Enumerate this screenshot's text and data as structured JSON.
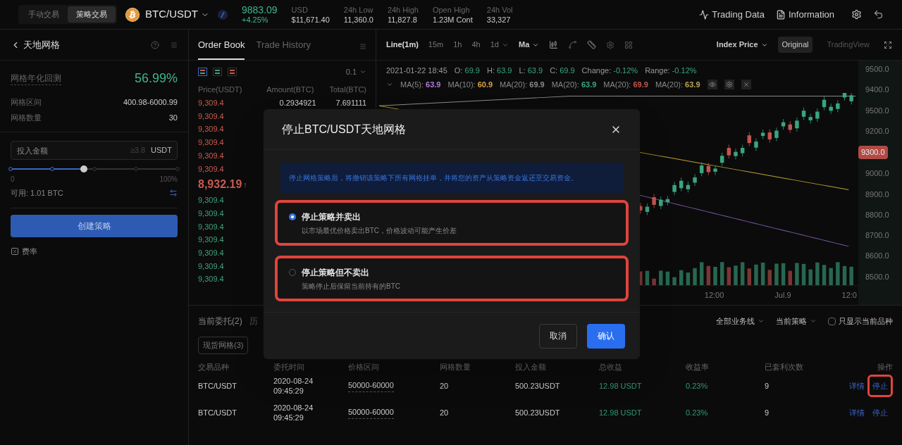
{
  "header": {
    "mode_tabs": [
      {
        "label": "手动交易",
        "selected": false
      },
      {
        "label": "策略交易",
        "selected": true
      }
    ],
    "pair": "BTC/USDT",
    "price": "9883.09",
    "change": "+4.25%",
    "stats": [
      {
        "label": "USD",
        "value": "$11,671.40"
      },
      {
        "label": "24h Low",
        "value": "11,360.0"
      },
      {
        "label": "24h High",
        "value": "11,827.8"
      },
      {
        "label": "Open High",
        "value": "1.23M Cont"
      },
      {
        "label": "24h Vol",
        "value": "33,327"
      }
    ],
    "links": [
      "Trading Data",
      "Information"
    ]
  },
  "strategy_panel": {
    "title": "天地网格",
    "annual_label": "网格年化回测",
    "annual_value": "56.99%",
    "params": [
      {
        "label": "网格区间",
        "value": "400.98-6000.99"
      },
      {
        "label": "网格数量",
        "value": "30"
      }
    ],
    "amount_field": {
      "placeholder": "投入金额",
      "hint": "≥3.8",
      "unit": "USDT"
    },
    "slider": {
      "level": 0.44,
      "min_label": "0",
      "max_label": "100%"
    },
    "available": "可用: 1.01 BTC",
    "create_button": "创建策略",
    "fee_link": "费率"
  },
  "order_book": {
    "tabs": [
      {
        "label": "Order Book",
        "selected": true
      },
      {
        "label": "Trade History",
        "selected": false
      }
    ],
    "views": [
      {
        "selected": true
      },
      {
        "selected": false
      },
      {
        "selected": false
      }
    ],
    "precision": "0.1",
    "columns": [
      "Price(USDT)",
      "Amount(BTC)",
      "Total(BTC)"
    ],
    "asks": [
      {
        "price": "9,309.4",
        "amount": "0.2934921",
        "total": "7.691111"
      },
      {
        "price": "9,309.4"
      },
      {
        "price": "9,309.4"
      },
      {
        "price": "9,309.4"
      },
      {
        "price": "9,309.4"
      },
      {
        "price": "9,309.4"
      }
    ],
    "last_price": "8,932.19",
    "last_arrow": "↑",
    "bids": [
      {
        "price": "9,309.4"
      },
      {
        "price": "9,309.4"
      },
      {
        "price": "9,309.4"
      },
      {
        "price": "9,309.4"
      },
      {
        "price": "9,309.4"
      },
      {
        "price": "9,309.4"
      },
      {
        "price": "9,309.4"
      }
    ]
  },
  "chart": {
    "intervals": [
      {
        "label": "Line(1m)",
        "selected": true
      },
      {
        "label": "15m",
        "selected": false
      },
      {
        "label": "1h",
        "selected": false
      },
      {
        "label": "4h",
        "selected": false
      },
      {
        "label": "1d",
        "selected": false
      }
    ],
    "indicator": "Ma",
    "price_type": "Index Price",
    "views": [
      {
        "label": "Original",
        "selected": true
      },
      {
        "label": "TradingView",
        "selected": false
      }
    ],
    "ohlc": [
      {
        "text": "2021-01-22 18:45"
      },
      {
        "label": "O:",
        "value": "69.9"
      },
      {
        "label": "H:",
        "value": "63.9"
      },
      {
        "label": "L:",
        "value": "63.9"
      },
      {
        "label": "C:",
        "value": "69.9"
      },
      {
        "label": "Change:",
        "value": "-0.12%"
      },
      {
        "label": "Range:",
        "value": "-0.12%"
      }
    ],
    "ma": [
      {
        "label": "MA(5):",
        "value": "63.9",
        "color": "#b07ad8"
      },
      {
        "label": "MA(10):",
        "value": "60.9",
        "color": "#d7a24a"
      },
      {
        "label": "MA(20):",
        "value": "69.9",
        "color": "#8a8a8a"
      },
      {
        "label": "MA(20):",
        "value": "63.9",
        "color": "#3aa57f"
      },
      {
        "label": "MA(20):",
        "value": "69.9",
        "color": "#c2554e"
      },
      {
        "label": "MA(20):",
        "value": "63.9",
        "color": "#b9a55a"
      }
    ],
    "price_axis": [
      {
        "text": "9500.0",
        "kind": "tick"
      },
      {
        "text": "9400.0",
        "kind": "tick"
      },
      {
        "text": "9500.0",
        "kind": "tick"
      },
      {
        "text": "9200.0",
        "kind": "tick"
      },
      {
        "text": "9300.0",
        "kind": "tag"
      },
      {
        "text": "9000.0",
        "kind": "tick"
      },
      {
        "text": "8900.0",
        "kind": "tick"
      },
      {
        "text": "8800.0",
        "kind": "tick"
      },
      {
        "text": "8700.0",
        "kind": "tick"
      },
      {
        "text": "8600.0",
        "kind": "tick"
      },
      {
        "text": "8500.0",
        "kind": "tick"
      }
    ],
    "time_axis": [
      "12:00",
      "Jul.9",
      "12:0"
    ]
  },
  "orders": {
    "tabs": [
      {
        "label": "当前委托(2)",
        "selected": true
      },
      {
        "label": "历",
        "selected": false
      }
    ],
    "chips": [
      "现货网格(3)"
    ],
    "filters": [
      "全部业务线",
      "当前策略"
    ],
    "only_current": {
      "label": "只显示当前品种",
      "checked": false
    },
    "columns": [
      "交易品种",
      "委托时间",
      "价格区间",
      "网格数量",
      "投入金额",
      "总收益",
      "收益率",
      "已套利次数",
      "操作"
    ],
    "rows": [
      {
        "pair": "BTC/USDT",
        "time": "2020-08-24\n09:45:29",
        "range": "50000-60000",
        "grids": "20",
        "amount": "500.23USDT",
        "profit": "12.98 USDT",
        "rate": "0.23%",
        "arbitrage": "9",
        "details": "详情",
        "stop": "停止",
        "highlighted": true
      },
      {
        "pair": "BTC/USDT",
        "time": "2020-08-24\n09:45:29",
        "range": "50000-60000",
        "grids": "20",
        "amount": "500.23USDT",
        "profit": "12.98 USDT",
        "rate": "0.23%",
        "arbitrage": "9",
        "details": "详情",
        "stop": "停止",
        "highlighted": false
      }
    ]
  },
  "dialog": {
    "title": "停止BTC/USDT天地网格",
    "notice": "停止网格策略后，将撤销该策略下所有网格挂单，并将您的资产从策略资金返还至交易资金。",
    "options": [
      {
        "title": "停止策略并卖出",
        "description": "以市场最优价格卖出BTC，价格波动可能产生价差",
        "selected": true,
        "highlighted": true
      },
      {
        "title": "停止策略但不卖出",
        "description": "策略停止后保留当前持有的BTC",
        "selected": false,
        "highlighted": true
      }
    ],
    "cancel": "取消",
    "confirm": "确认"
  }
}
